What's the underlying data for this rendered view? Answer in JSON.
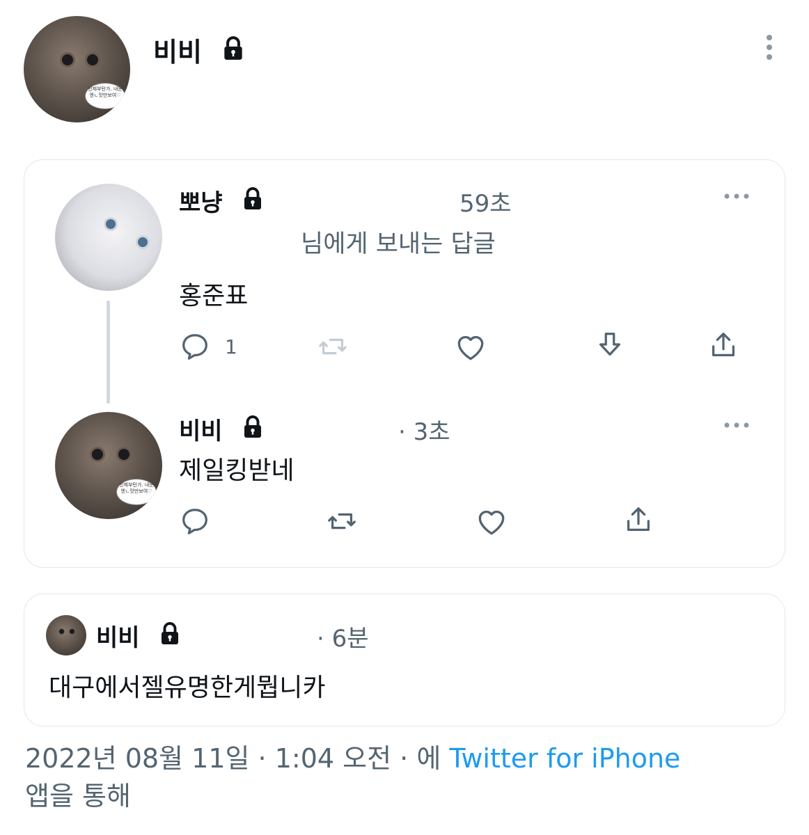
{
  "tweet": {
    "author_name": "비비",
    "protected": true,
    "icons": {
      "lock": "lock-icon",
      "more": "more-options-icon"
    }
  },
  "quoted_card": {
    "reply": {
      "author_name": "뽀냥",
      "time": "59초",
      "replying_to": "님에게 보내는 답글",
      "text": "홍준표",
      "reply_count": "1",
      "actions": [
        "reply-icon",
        "retweet-icon",
        "like-icon",
        "bookmark-icon",
        "share-icon"
      ]
    },
    "answer": {
      "author_name": "비비",
      "time": "· 3초",
      "text": "제일킹받네",
      "actions": [
        "reply-icon",
        "retweet-icon",
        "like-icon",
        "share-icon"
      ]
    }
  },
  "quoted_tweet": {
    "author_name": "비비",
    "time": "· 6분",
    "text": "대구에서젤유명한게뭡니카"
  },
  "avatar_caption": "인제부턴가. 내눈 엔ㄴ맛만보여♡",
  "footer": {
    "date": "2022년 08월 11일",
    "separator": "·",
    "time": "1:04 오전",
    "via_prefix": "· 에",
    "client": "Twitter for iPhone",
    "via_suffix": "앱을 통해"
  },
  "colors": {
    "text": "#0f1419",
    "muted": "#536471",
    "link": "#1d9bf0",
    "border": "#e1e8ed"
  }
}
